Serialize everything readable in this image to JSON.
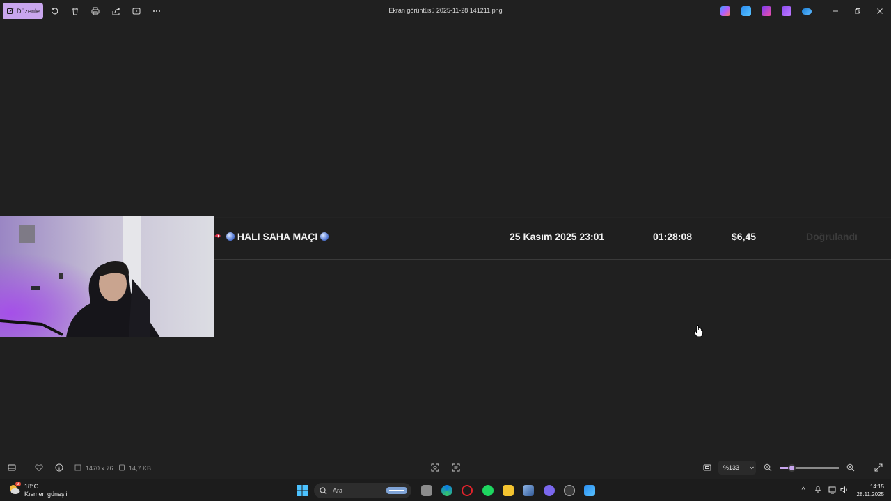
{
  "titlebar": {
    "edit_label": "Düzenle",
    "title": "Ekran görüntüsü 2025-11-28 141211.png",
    "icons": [
      "rotate-icon",
      "delete-icon",
      "print-icon",
      "share-icon",
      "slideshow-icon",
      "more-icon"
    ],
    "app_icons": [
      "copilot-icon",
      "photos-icon",
      "clipchamp-icon",
      "designer-icon",
      "onedrive-icon"
    ]
  },
  "row": {
    "title": "HALI SAHA MAÇI",
    "date": "25 Kasım 2025 23:01",
    "duration": "01:28:08",
    "price": "$6,45",
    "status": "Doğrulandı"
  },
  "statusbar": {
    "dimensions": "1470 x 76",
    "filesize": "14,7 KB",
    "zoom": "%133",
    "zoom_percent": 133,
    "zoom_slider_fraction": 0.2
  },
  "taskbar": {
    "weather_temp": "18°C",
    "weather_desc": "Kısmen güneşli",
    "weather_badge": "2",
    "search_placeholder": "Ara",
    "time": "14:15",
    "date": "28.11.2025"
  },
  "colors": {
    "accent": "#c9a6ee",
    "background": "#202020"
  }
}
